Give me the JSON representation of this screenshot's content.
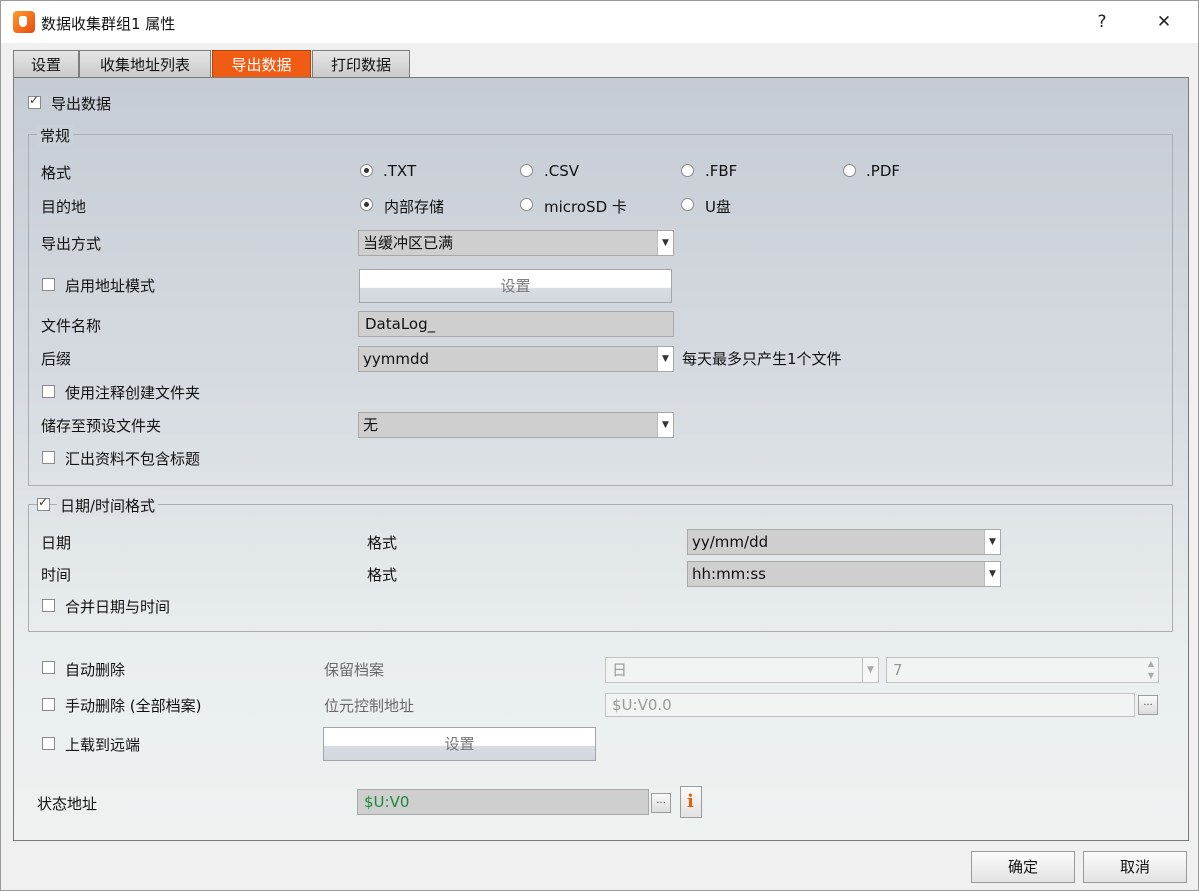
{
  "window": {
    "title": "数据收集群组1 属性",
    "help_label": "?",
    "close_label": "✕"
  },
  "tabs": [
    {
      "label": "设置",
      "active": false
    },
    {
      "label": "收集地址列表",
      "active": false
    },
    {
      "label": "导出数据",
      "active": true
    },
    {
      "label": "打印数据",
      "active": false
    }
  ],
  "export": {
    "enable_label": "导出数据",
    "enabled": true
  },
  "general": {
    "legend": "常规",
    "format_label": "格式",
    "format_options": [
      {
        "label": ".TXT",
        "selected": true
      },
      {
        "label": ".CSV",
        "selected": false
      },
      {
        "label": ".FBF",
        "selected": false
      },
      {
        "label": ".PDF",
        "selected": false
      }
    ],
    "destination_label": "目的地",
    "destination_options": [
      {
        "label": "内部存储",
        "selected": true
      },
      {
        "label": "microSD 卡",
        "selected": false
      },
      {
        "label": "U盘",
        "selected": false
      }
    ],
    "export_mode_label": "导出方式",
    "export_mode_value": "当缓冲区已满",
    "address_mode_label": "启用地址模式",
    "address_mode_checked": false,
    "settings_button": "设置",
    "filename_label": "文件名称",
    "filename_value": "DataLog_",
    "suffix_label": "后缀",
    "suffix_value": "yymmdd",
    "suffix_note": "每天最多只产生1个文件",
    "comment_folder_label": "使用注释创建文件夹",
    "comment_folder_checked": false,
    "preset_folder_label": "储存至预设文件夹",
    "preset_folder_value": "无",
    "no_header_label": "汇出资料不包含标题",
    "no_header_checked": false
  },
  "datetime": {
    "legend": "日期/时间格式",
    "enabled": true,
    "date_label": "日期",
    "date_format_label": "格式",
    "date_format_value": "yy/mm/dd",
    "time_label": "时间",
    "time_format_label": "格式",
    "time_format_value": "hh:mm:ss",
    "merge_label": "合并日期与时间",
    "merge_checked": false
  },
  "bottom": {
    "auto_delete_label": "自动删除",
    "auto_delete_checked": false,
    "keep_files_label": "保留档案",
    "keep_unit_value": "日",
    "keep_count_value": "7",
    "manual_delete_label": "手动删除 (全部档案)",
    "manual_delete_checked": false,
    "bit_address_label": "位元控制地址",
    "bit_address_value": "$U:V0.0",
    "upload_label": "上载到远端",
    "upload_checked": false,
    "upload_settings_button": "设置",
    "status_address_label": "状态地址",
    "status_address_value": "$U:V0",
    "ellipsis": "..."
  },
  "footer": {
    "ok_label": "确定",
    "cancel_label": "取消"
  }
}
